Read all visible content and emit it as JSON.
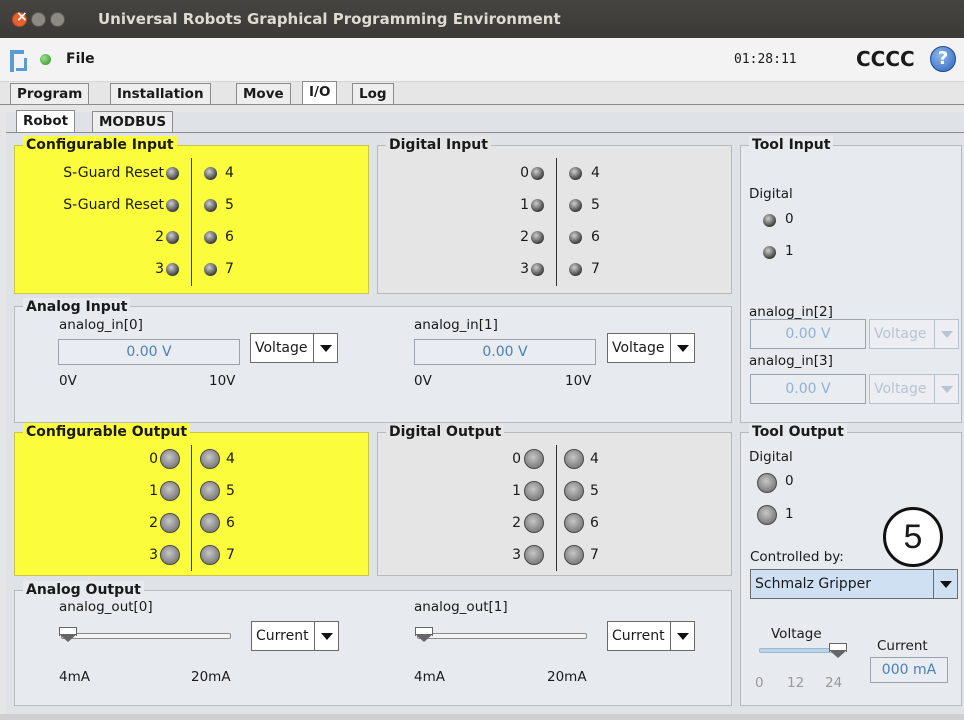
{
  "window": {
    "title": "Universal Robots Graphical Programming Environment"
  },
  "topbar": {
    "file_menu": "File",
    "time": "01:28:11",
    "robot_name": "CCCC",
    "help_symbol": "?"
  },
  "tabs": {
    "main": [
      "Program",
      "Installation",
      "Move",
      "I/O",
      "Log"
    ],
    "main_active": "I/O",
    "sub": [
      "Robot",
      "MODBUS"
    ],
    "sub_active": "Robot"
  },
  "configurable_input": {
    "title": "Configurable Input",
    "left": [
      "S-Guard Reset",
      "S-Guard Reset",
      "2",
      "3"
    ],
    "right": [
      "4",
      "5",
      "6",
      "7"
    ]
  },
  "digital_input": {
    "title": "Digital Input",
    "left": [
      "0",
      "1",
      "2",
      "3"
    ],
    "right": [
      "4",
      "5",
      "6",
      "7"
    ]
  },
  "tool_input": {
    "title": "Tool Input",
    "digital_label": "Digital",
    "digital": [
      "0",
      "1"
    ],
    "analog_in2": {
      "label": "analog_in[2]",
      "value": "0.00 V",
      "mode": "Voltage"
    },
    "analog_in3": {
      "label": "analog_in[3]",
      "value": "0.00 V",
      "mode": "Voltage"
    }
  },
  "analog_input": {
    "title": "Analog Input",
    "ch0": {
      "label": "analog_in[0]",
      "value": "0.00 V",
      "mode": "Voltage",
      "min": "0V",
      "max": "10V"
    },
    "ch1": {
      "label": "analog_in[1]",
      "value": "0.00 V",
      "mode": "Voltage",
      "min": "0V",
      "max": "10V"
    }
  },
  "configurable_output": {
    "title": "Configurable Output",
    "left": [
      "0",
      "1",
      "2",
      "3"
    ],
    "right": [
      "4",
      "5",
      "6",
      "7"
    ]
  },
  "digital_output": {
    "title": "Digital Output",
    "left": [
      "0",
      "1",
      "2",
      "3"
    ],
    "right": [
      "4",
      "5",
      "6",
      "7"
    ]
  },
  "tool_output": {
    "title": "Tool Output",
    "digital_label": "Digital",
    "digital": [
      "0",
      "1"
    ],
    "controlled_by_label": "Controlled by:",
    "controlled_by_value": "Schmalz Gripper",
    "voltage_label": "Voltage",
    "voltage_ticks": [
      "0",
      "12",
      "24"
    ],
    "voltage_level": 24,
    "current_label": "Current",
    "current_value": "000 mA"
  },
  "analog_output": {
    "title": "Analog Output",
    "ch0": {
      "label": "analog_out[0]",
      "mode": "Current",
      "min": "4mA",
      "max": "20mA",
      "level": 0
    },
    "ch1": {
      "label": "analog_out[1]",
      "mode": "Current",
      "min": "4mA",
      "max": "20mA",
      "level": 0
    }
  },
  "callout": {
    "number": "5"
  }
}
